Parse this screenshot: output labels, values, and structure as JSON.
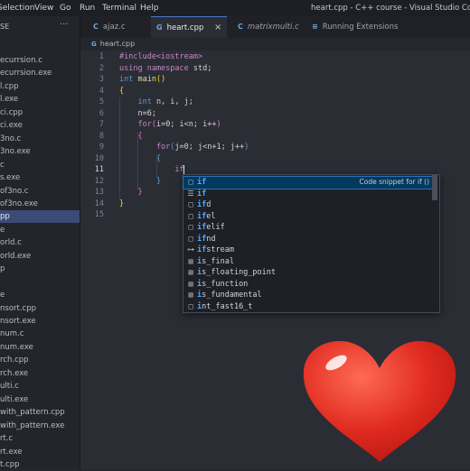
{
  "titlebar": {
    "menu": [
      "Selection",
      "View",
      "Go",
      "Run",
      "Terminal",
      "Help"
    ],
    "window_title": "heart.cpp - C++ course - Visual Studio Code"
  },
  "sidebar": {
    "header": "SE",
    "more_icon": "ellipsis-icon",
    "files": [
      "ecurrsion.c",
      "ecurrsion.exe",
      "l.cpp",
      "l.exe",
      "ci.cpp",
      "ci.exe",
      "3no.c",
      "3no.exe",
      "c",
      "s.exe",
      "of3no.c",
      "of3no.exe",
      "pp",
      "e",
      "orld.c",
      "orld.exe",
      "p",
      "",
      "e",
      "nsort.cpp",
      "nsort.exe",
      "num.c",
      "num.exe",
      "rch.cpp",
      "rch.exe",
      "ulti.c",
      "ulti.exe",
      "with_pattern.cpp",
      "with_pattern.exe",
      "rt.c",
      "rt.exe",
      "t.cpp"
    ],
    "selected_index": 12
  },
  "tabs": [
    {
      "label": "ajaz.c",
      "icon": "C",
      "active": false
    },
    {
      "label": "heart.cpp",
      "icon": "G",
      "active": true,
      "close": "×"
    },
    {
      "label": "matrixmulti.c",
      "icon": "C",
      "active": false
    },
    {
      "label": "Running Extensions",
      "icon": "≡",
      "active": false
    }
  ],
  "breadcrumb": {
    "icon": "G",
    "label": "heart.cpp"
  },
  "editor": {
    "line_numbers": [
      "1",
      "2",
      "3",
      "4",
      "5",
      "6",
      "7",
      "8",
      "9",
      "10",
      "11",
      "12",
      "13",
      "14",
      "15"
    ],
    "current_line": 11,
    "lines": [
      [
        {
          "t": "#include<iostream>",
          "c": "kw"
        }
      ],
      [
        {
          "t": "using namespace ",
          "c": "kw"
        },
        {
          "t": "std;",
          "c": "tx"
        }
      ],
      [
        {
          "t": "int ",
          "c": "ty"
        },
        {
          "t": "main",
          "c": "fn"
        },
        {
          "t": "()",
          "c": "br"
        }
      ],
      [
        {
          "t": "{",
          "c": "br"
        }
      ],
      [
        {
          "t": "    int ",
          "c": "ty"
        },
        {
          "t": "n, i, j;",
          "c": "tx"
        }
      ],
      [
        {
          "t": "    n=6;",
          "c": "tx"
        }
      ],
      [
        {
          "t": "    for",
          "c": "kw"
        },
        {
          "t": "(",
          "c": "br2"
        },
        {
          "t": "i=0; i<n; i++",
          "c": "tx"
        },
        {
          "t": ")",
          "c": "br2"
        }
      ],
      [
        {
          "t": "    {",
          "c": "br2"
        }
      ],
      [
        {
          "t": "        for",
          "c": "kw"
        },
        {
          "t": "(",
          "c": "ty"
        },
        {
          "t": "j=0; j<n+1; j++",
          "c": "tx"
        },
        {
          "t": ")",
          "c": "ty"
        }
      ],
      [
        {
          "t": "        {",
          "c": "ty"
        }
      ],
      [
        {
          "t": "            if",
          "c": "kw"
        }
      ],
      [
        {
          "t": "        }",
          "c": "ty"
        }
      ],
      [
        {
          "t": "    }",
          "c": "br2"
        }
      ],
      [
        {
          "t": "}",
          "c": "br"
        }
      ],
      []
    ]
  },
  "suggest": {
    "items": [
      {
        "label": "if",
        "match": "if",
        "rest": "",
        "icon": "snippet-icon",
        "glyph": "□",
        "detail": "Code snippet for if ()",
        "selected": true
      },
      {
        "label": "if",
        "match": "if",
        "rest": "",
        "icon": "keyword-icon",
        "glyph": "☰"
      },
      {
        "label": "ifd",
        "match": "if",
        "rest": "d",
        "icon": "snippet-icon",
        "glyph": "□"
      },
      {
        "label": "ifel",
        "match": "if",
        "rest": "el",
        "icon": "snippet-icon",
        "glyph": "□"
      },
      {
        "label": "ifelif",
        "match": "if",
        "rest": "elif",
        "icon": "snippet-icon",
        "glyph": "□"
      },
      {
        "label": "ifnd",
        "match": "if",
        "rest": "nd",
        "icon": "snippet-icon",
        "glyph": "□"
      },
      {
        "label": "ifstream",
        "match": "if",
        "rest": "stream",
        "icon": "class-icon",
        "glyph": "⊶"
      },
      {
        "label": "is_final",
        "match": "i",
        "rest": "s_final",
        "icon": "struct-icon",
        "glyph": "▤"
      },
      {
        "label": "is_floating_point",
        "match": "i",
        "rest": "s_floating_point",
        "icon": "struct-icon",
        "glyph": "▤"
      },
      {
        "label": "is_function",
        "match": "i",
        "rest": "s_function",
        "icon": "struct-icon",
        "glyph": "▤"
      },
      {
        "label": "is_fundamental",
        "match": "i",
        "rest": "s_fundamental",
        "icon": "struct-icon",
        "glyph": "▤"
      },
      {
        "label": "int_fast16_t",
        "match": "i",
        "rest": "nt_fast16_t",
        "icon": "typedef-icon",
        "glyph": "□"
      }
    ]
  },
  "sticker": {
    "icon": "heart-icon",
    "color": "#e02b20"
  }
}
